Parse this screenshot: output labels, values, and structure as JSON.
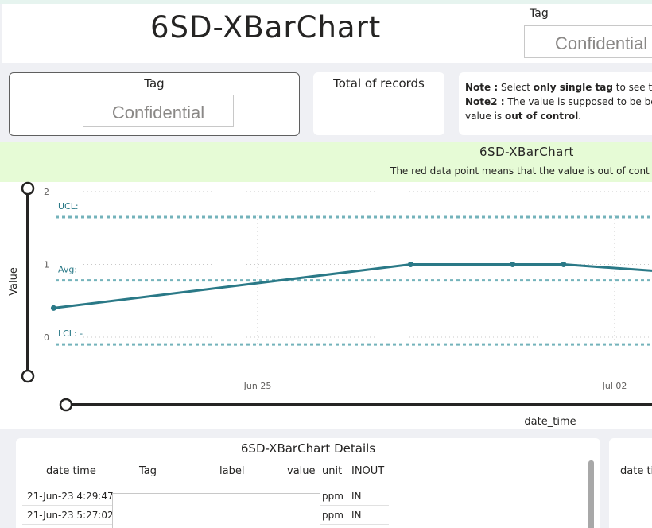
{
  "header": {
    "title": "6SD-XBarChart",
    "tag_label": "Tag",
    "tag_value": "Confidential"
  },
  "tag_card": {
    "label": "Tag",
    "value": "Confidential"
  },
  "records_card": {
    "label": "Total of records"
  },
  "notes": {
    "n1_prefix": "Note :",
    "n1_text_a": " Select ",
    "n1_bold": "only single tag",
    "n1_text_b": " to see th",
    "n2_prefix": "Note2 :",
    "n2_text": " The value is supposed to be be",
    "n3_text": "value is ",
    "n3_bold": "out of control",
    "n3_end": "."
  },
  "chart_data": {
    "type": "line",
    "title": "6SD-XBarChart",
    "subtitle": "The red data point means that the value is out of cont",
    "xlabel": "date_time",
    "ylabel": "Value",
    "x_ticks": [
      "Jun 25",
      "Jul 02"
    ],
    "y_ticks": [
      0,
      1,
      2
    ],
    "ylim": [
      0,
      2
    ],
    "grid": true,
    "reference_lines": [
      {
        "label": "UCL:",
        "value": 1.65
      },
      {
        "label": "Avg:",
        "value": 0.78
      },
      {
        "label": "LCL: -",
        "value": -0.1
      }
    ],
    "series": [
      {
        "color": "#2a7987",
        "points": [
          {
            "x": "2023-06-21",
            "y": 0.4
          },
          {
            "x": "2023-06-28",
            "y": 1.0
          },
          {
            "x": "2023-06-30",
            "y": 1.0
          },
          {
            "x": "2023-07-01",
            "y": 1.0
          },
          {
            "x": "2023-07-03",
            "y": 0.9
          }
        ]
      }
    ],
    "colors": {
      "line": "#2a7987",
      "ref_line": "#74b3bb",
      "grid": "#c8c8c8"
    }
  },
  "details": {
    "title": "6SD-XBarChart Details",
    "columns": [
      "date time",
      "Tag",
      "label",
      "value",
      "unit",
      "INOUT"
    ],
    "rows": [
      {
        "date_time": "21-Jun-23 4:29:47",
        "unit": "ppm",
        "inout": "IN"
      },
      {
        "date_time": "21-Jun-23 5:27:02",
        "unit": "ppm",
        "inout": "IN"
      }
    ]
  },
  "details2": {
    "first_col": "date ti"
  }
}
